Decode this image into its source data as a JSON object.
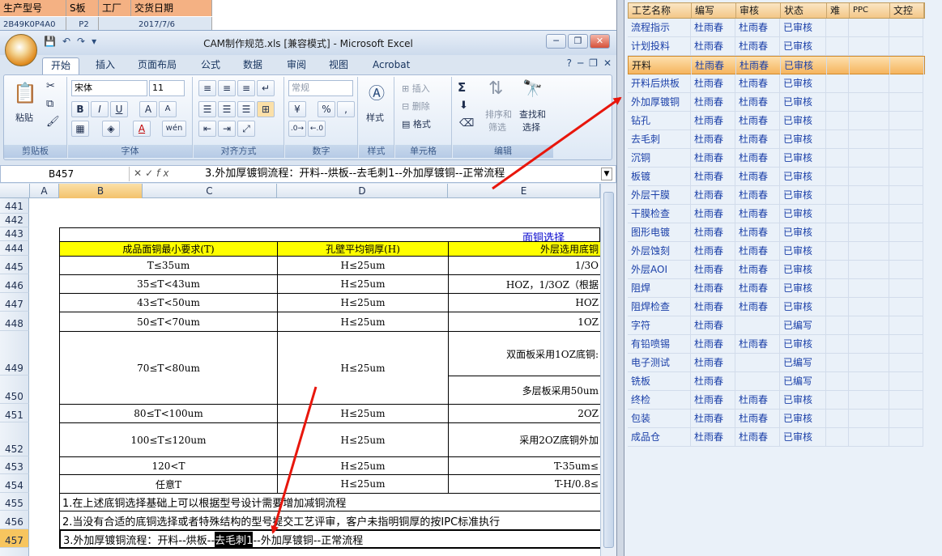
{
  "bg_sheet": {
    "headers": [
      "生产型号",
      "S板",
      "工厂",
      "交货日期"
    ],
    "row": [
      "2B49K0P4A0",
      "P2",
      "2017/7/6",
      ""
    ]
  },
  "window": {
    "title": "CAM制作规范.xls  [兼容模式] - Microsoft Excel",
    "qat": [
      "💾",
      "↶",
      "↷",
      "▾"
    ],
    "controls": [
      "─",
      "❐",
      "✕"
    ]
  },
  "tabs": [
    "开始",
    "插入",
    "页面布局",
    "公式",
    "数据",
    "审阅",
    "视图",
    "Acrobat"
  ],
  "tab_right": [
    "?",
    "─",
    "❐",
    "✕"
  ],
  "ribbon": {
    "clipboard": {
      "label": "剪贴板",
      "paste": "粘贴"
    },
    "font": {
      "label": "字体",
      "name": "宋体",
      "size": "11",
      "bold": "B",
      "italic": "I",
      "underline": "U",
      "grow": "A",
      "shrink": "A",
      "color": "A",
      "wen": "wén"
    },
    "align": {
      "label": "对齐方式"
    },
    "number": {
      "label": "数字",
      "format": "常规",
      "pct": "%",
      "comma": ","
    },
    "styles": {
      "label": "样式"
    },
    "cells": {
      "label": "单元格",
      "insert": "插入",
      "delete": "删除",
      "format": "格式"
    },
    "edit": {
      "label": "编辑",
      "sigma": "Σ",
      "sort1": "排序和",
      "sort2": "筛选",
      "find1": "查找和",
      "find2": "选择"
    }
  },
  "formula_bar": {
    "name_box": "B457",
    "fx": "fx",
    "content": "3.外加厚镀铜流程：开料--烘板--去毛刺1--外加厚镀铜--正常流程"
  },
  "columns": [
    "",
    "A",
    "B",
    "C",
    "D",
    "E"
  ],
  "rows": [
    "441",
    "442",
    "443",
    "444",
    "445",
    "446",
    "447",
    "448",
    "449",
    "450",
    "451",
    "452",
    "453",
    "454",
    "455",
    "456",
    "457",
    ""
  ],
  "sheet": {
    "link": "面铜选择",
    "headers": [
      "成品面铜最小要求(T)",
      "孔壁平均铜厚(H)",
      "外层选用底铜"
    ],
    "table": [
      [
        "T≤35um",
        "H≤25um",
        "1/3O"
      ],
      [
        "35≤T<43um",
        "H≤25um",
        "HOZ，1/3OZ（根据"
      ],
      [
        "43≤T<50um",
        "H≤25um",
        "HOZ"
      ],
      [
        "50≤T<70um",
        "H≤25um",
        "1OZ"
      ],
      [
        "70≤T<80um",
        "H≤25um",
        "双面板采用1OZ底铜:"
      ],
      [
        "",
        "",
        "多层板采用50um"
      ],
      [
        "80≤T<100um",
        "H≤25um",
        "2OZ"
      ],
      [
        "100≤T≤120um",
        "H≤25um",
        "采用2OZ底铜外加"
      ],
      [
        "120<T",
        "H≤25um",
        "T-35um≤"
      ],
      [
        "任意T",
        "H≤25um",
        "T-H/0.8≤"
      ]
    ],
    "note1": "1.在上述底铜选择基础上可以根据型号设计需要增加减铜流程",
    "note2": "2.当没有合适的底铜选择或者特殊结构的型号提交工艺评审，客户未指明铜厚的按IPC标准执行",
    "note3_a": "3.外加厚镀铜流程：开料--烘板--",
    "note3_b": "去毛刺1",
    "note3_c": "--外加厚镀铜--正常流程"
  },
  "panel": {
    "headers": [
      "工艺名称",
      "编写",
      "审核",
      "状态",
      "难",
      "PPC",
      "文控"
    ],
    "rows": [
      {
        "name": "流程指示",
        "writer": "杜雨春",
        "reviewer": "杜雨春",
        "status": "已审核"
      },
      {
        "name": "计划投料",
        "writer": "杜雨春",
        "reviewer": "杜雨春",
        "status": "已审核"
      },
      {
        "name": "开料",
        "writer": "杜雨春",
        "reviewer": "杜雨春",
        "status": "已审核"
      },
      {
        "name": "开料后烘板",
        "writer": "杜雨春",
        "reviewer": "杜雨春",
        "status": "已审核"
      },
      {
        "name": "外加厚镀铜",
        "writer": "杜雨春",
        "reviewer": "杜雨春",
        "status": "已审核"
      },
      {
        "name": "钻孔",
        "writer": "杜雨春",
        "reviewer": "杜雨春",
        "status": "已审核"
      },
      {
        "name": "去毛刺",
        "writer": "杜雨春",
        "reviewer": "杜雨春",
        "status": "已审核"
      },
      {
        "name": "沉铜",
        "writer": "杜雨春",
        "reviewer": "杜雨春",
        "status": "已审核"
      },
      {
        "name": "板镀",
        "writer": "杜雨春",
        "reviewer": "杜雨春",
        "status": "已审核"
      },
      {
        "name": "外层干膜",
        "writer": "杜雨春",
        "reviewer": "杜雨春",
        "status": "已审核"
      },
      {
        "name": "干膜检查",
        "writer": "杜雨春",
        "reviewer": "杜雨春",
        "status": "已审核"
      },
      {
        "name": "图形电镀",
        "writer": "杜雨春",
        "reviewer": "杜雨春",
        "status": "已审核"
      },
      {
        "name": "外层蚀刻",
        "writer": "杜雨春",
        "reviewer": "杜雨春",
        "status": "已审核"
      },
      {
        "name": "外层AOI",
        "writer": "杜雨春",
        "reviewer": "杜雨春",
        "status": "已审核"
      },
      {
        "name": "阻焊",
        "writer": "杜雨春",
        "reviewer": "杜雨春",
        "status": "已审核"
      },
      {
        "name": "阻焊检查",
        "writer": "杜雨春",
        "reviewer": "杜雨春",
        "status": "已审核"
      },
      {
        "name": "字符",
        "writer": "杜雨春",
        "reviewer": "",
        "status": "已编写"
      },
      {
        "name": "有铅喷锡",
        "writer": "杜雨春",
        "reviewer": "杜雨春",
        "status": "已审核"
      },
      {
        "name": "电子测试",
        "writer": "杜雨春",
        "reviewer": "",
        "status": "已编写"
      },
      {
        "name": "铣板",
        "writer": "杜雨春",
        "reviewer": "",
        "status": "已编写"
      },
      {
        "name": "终检",
        "writer": "杜雨春",
        "reviewer": "杜雨春",
        "status": "已审核"
      },
      {
        "name": "包装",
        "writer": "杜雨春",
        "reviewer": "杜雨春",
        "status": "已审核"
      },
      {
        "name": "成品仓",
        "writer": "杜雨春",
        "reviewer": "杜雨春",
        "status": "已审核"
      }
    ]
  },
  "colors": {
    "accent": "#f5b45e",
    "arrow": "#e8160c",
    "header_yellow": "#ffff00"
  }
}
